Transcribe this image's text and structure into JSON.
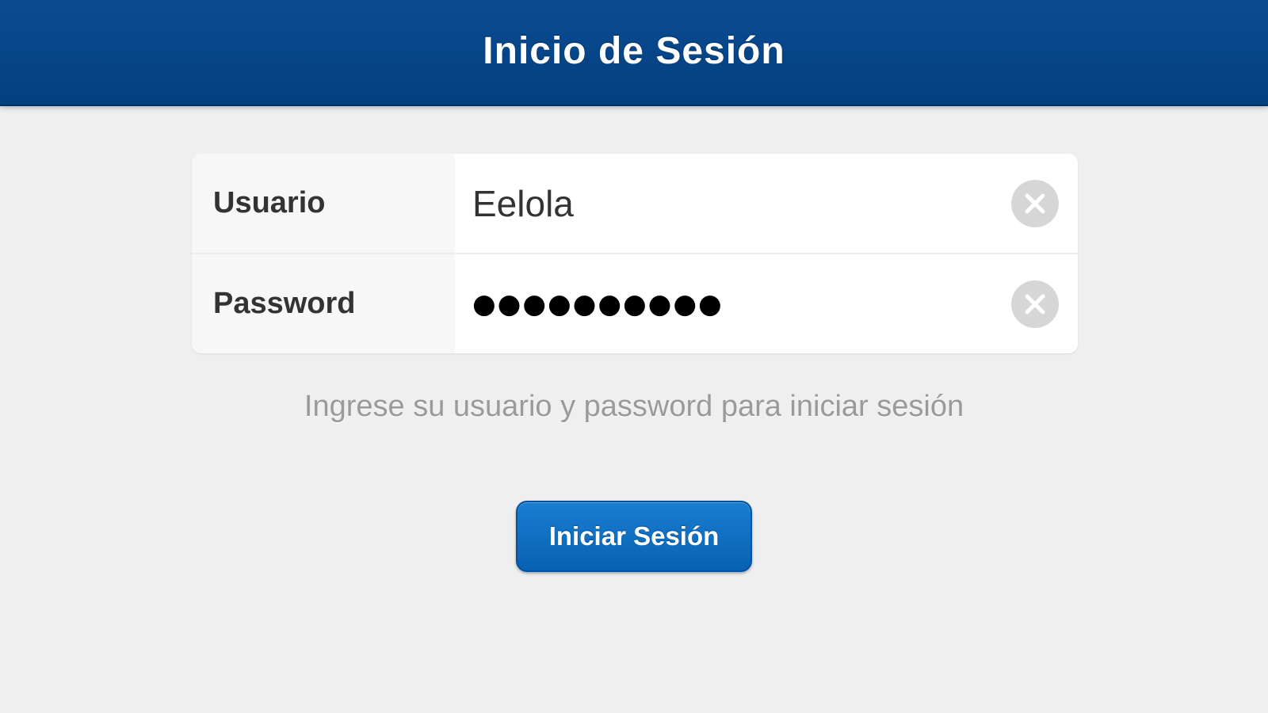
{
  "navbar": {
    "title": "Inicio de Sesión"
  },
  "form": {
    "username": {
      "label": "Usuario",
      "value": "Eelola",
      "clear_icon": "clear-icon"
    },
    "password": {
      "label": "Password",
      "value": "●●●●●●●●●●",
      "clear_icon": "clear-icon"
    }
  },
  "hint": "Ingrese su usuario y password para iniciar sesión",
  "login_button": {
    "label": "Iniciar Sesión"
  },
  "colors": {
    "navbar": "#034080",
    "button": "#0a6cc2",
    "background": "#efefef"
  }
}
